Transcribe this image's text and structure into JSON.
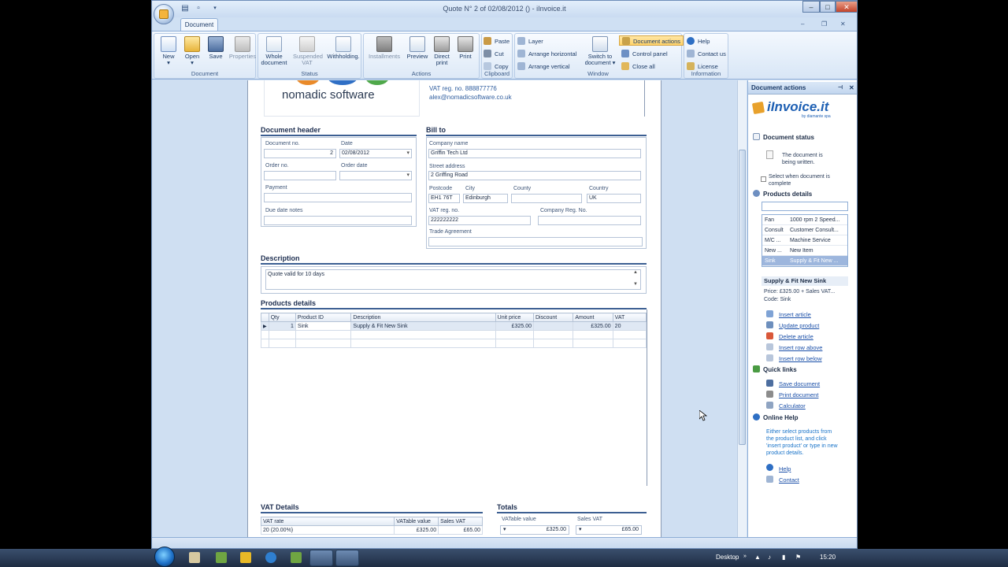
{
  "window": {
    "title": "Quote N° 2 of 02/08/2012 () - iInvoice.it"
  },
  "ribbon": {
    "tab": "Document",
    "groups": {
      "document": {
        "label": "Document",
        "new": "New",
        "open": "Open",
        "save": "Save",
        "properties": "Properties"
      },
      "status": {
        "label": "Status",
        "whole_document_1": "Whole",
        "whole_document_2": "document",
        "suspended_vat_1": "Suspended",
        "suspended_vat_2": "VAT",
        "withholding": "Withholding."
      },
      "actions": {
        "label": "Actions",
        "installments": "Installments",
        "preview": "Preview",
        "direct_print_1": "Direct",
        "direct_print_2": "print",
        "print": "Print"
      },
      "clipboard": {
        "label": "Clipboard",
        "paste": "Paste",
        "cut": "Cut",
        "copy": "Copy"
      },
      "window": {
        "label": "Window",
        "layer": "Layer",
        "arrange_horizontal": "Arrange horizontal",
        "arrange_vertical": "Arrange vertical",
        "switch_1": "Switch to",
        "switch_2": "document",
        "document_actions": "Document actions",
        "control_panel": "Control panel",
        "close_all": "Close all"
      },
      "information": {
        "label": "Information",
        "help": "Help",
        "contact_us": "Contact us",
        "license": "License"
      }
    }
  },
  "company": {
    "logo_text": "nomadic software",
    "vat_reg": "VAT reg. no. 888877776",
    "email": "alex@nomadicsoftware.co.uk"
  },
  "document_header": {
    "title": "Document header",
    "document_no_label": "Document no.",
    "document_no": "2",
    "date_label": "Date",
    "date": "02/08/2012",
    "order_no_label": "Order no.",
    "order_date_label": "Order date",
    "payment_label": "Payment",
    "due_date_notes_label": "Due date notes"
  },
  "bill_to": {
    "title": "Bill to",
    "company_name_label": "Company name",
    "company_name": "Griffin Tech Ltd",
    "street_label": "Street address",
    "street": "2 Griffing Road",
    "postcode_label": "Postcode",
    "postcode": "EH1 76T",
    "city_label": "City",
    "city": "Edinburgh",
    "county_label": "County",
    "country_label": "Country",
    "country": "UK",
    "vat_reg_label": "VAT reg. no.",
    "vat_reg": "222222222",
    "company_reg_label": "Company Reg. No.",
    "trade_agreement_label": "Trade Agreement"
  },
  "description": {
    "title": "Description",
    "text": "Quote valid for 10 days"
  },
  "products": {
    "title": "Products details",
    "columns": [
      "Qty",
      "Product ID",
      "Description",
      "Unit price",
      "Discount",
      "Amount",
      "VAT"
    ],
    "rows": [
      [
        "1",
        "Sink",
        "Supply & Fit New Sink",
        "£325.00",
        "",
        "£325.00",
        "20"
      ]
    ]
  },
  "vat_details": {
    "title": "VAT Details",
    "columns": [
      "VAT rate",
      "VATable value",
      "Sales VAT"
    ],
    "rows": [
      [
        "20 (20.00%)",
        "£325.00",
        "£65.00"
      ]
    ]
  },
  "totals": {
    "title": "Totals",
    "vatable_label": "VATable value",
    "vatable": "£325.00",
    "sales_vat_label": "Sales VAT",
    "sales_vat": "£65.00"
  },
  "panel": {
    "header": "Document actions",
    "brand": "iInvoice.it",
    "brand_sub": "by diamante spa",
    "status_title": "Document status",
    "status_text_1": "The document is",
    "status_text_2": "being written.",
    "select_when_1": "Select when document is",
    "select_when_2": "complete",
    "products_title": "Products details",
    "product_list": [
      [
        "Fan",
        "1000 rpm 2 Speed..."
      ],
      [
        "Consult",
        "Customer Consult..."
      ],
      [
        "M/C ...",
        "Machine Service"
      ],
      [
        "New ...",
        "New Item"
      ],
      [
        "Sink",
        "Supply & Fit New ..."
      ]
    ],
    "selected_name": "Supply & Fit New Sink",
    "selected_price": "Price: £325.00 + Sales VAT...",
    "selected_code": "Code: Sink",
    "actions": [
      "Insert article",
      "Update product",
      "Delete article",
      "Insert row above",
      "Insert row below"
    ],
    "quick_links_title": "Quick links",
    "quick_links": [
      "Save document",
      "Print document",
      "Calculator"
    ],
    "online_help_title": "Online Help",
    "online_help_text": [
      "Either select products from",
      "the product list, and click",
      "'insert product' or type in new",
      "product details."
    ],
    "help_links": [
      "Help",
      "Contact"
    ]
  },
  "taskbar": {
    "desktop": "Desktop",
    "clock": "15:20"
  }
}
